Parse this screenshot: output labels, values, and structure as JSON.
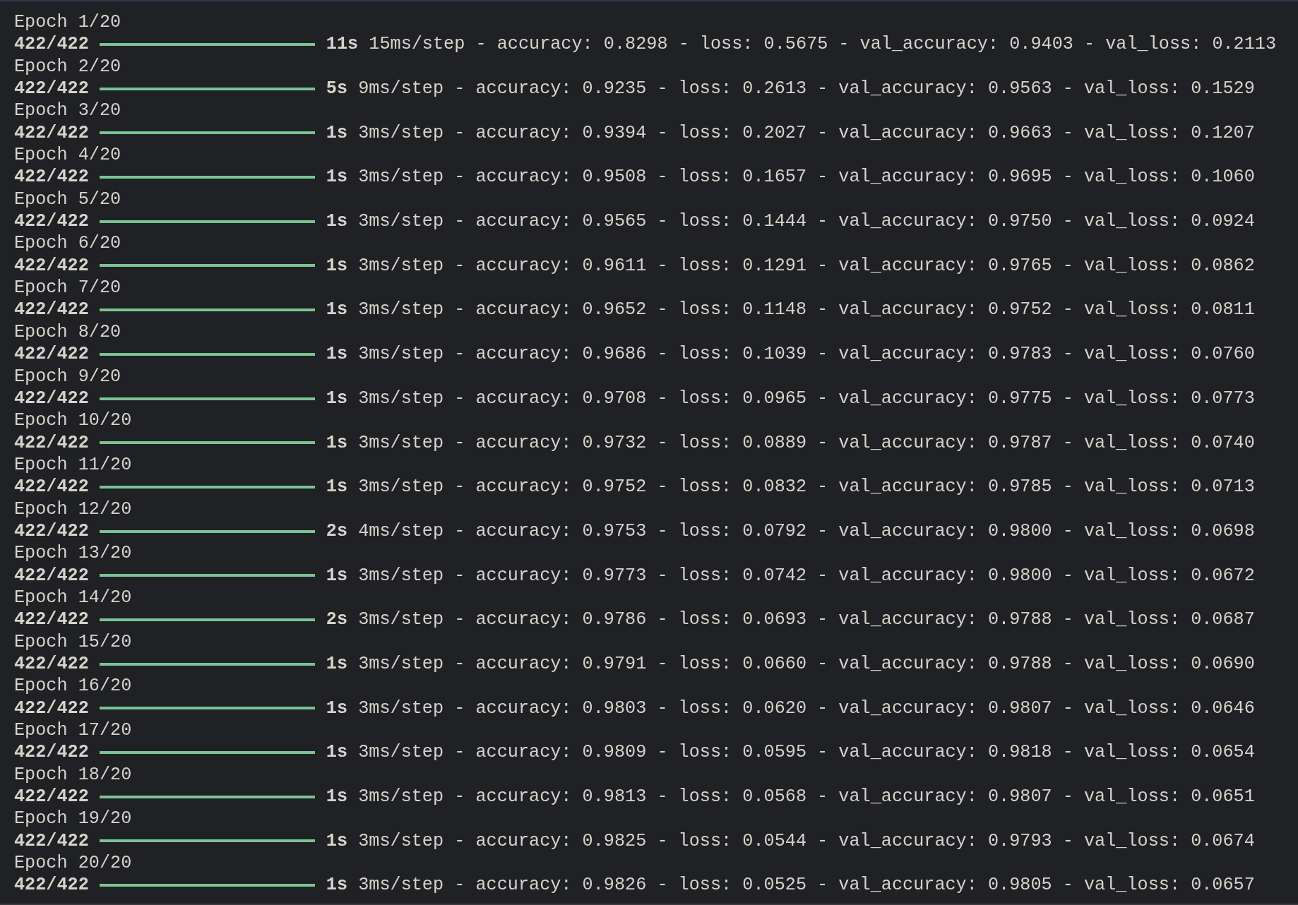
{
  "epochs": [
    {
      "header": "Epoch 1/20",
      "steps": "422/422",
      "level": 1,
      "time": "11s",
      "detail": "15ms/step - accuracy: 0.8298 - loss: 0.5675 - val_accuracy: 0.9403 - val_loss: 0.2113"
    },
    {
      "header": "Epoch 2/20",
      "steps": "422/422",
      "level": 1,
      "time": "5s",
      "detail": "9ms/step - accuracy: 0.9235 - loss: 0.2613 - val_accuracy: 0.9563 - val_loss: 0.1529"
    },
    {
      "header": "Epoch 3/20",
      "steps": "422/422",
      "level": 1,
      "time": "1s",
      "detail": "3ms/step - accuracy: 0.9394 - loss: 0.2027 - val_accuracy: 0.9663 - val_loss: 0.1207"
    },
    {
      "header": "Epoch 4/20",
      "steps": "422/422",
      "level": 1,
      "time": "1s",
      "detail": "3ms/step - accuracy: 0.9508 - loss: 0.1657 - val_accuracy: 0.9695 - val_loss: 0.1060"
    },
    {
      "header": "Epoch 5/20",
      "steps": "422/422",
      "level": 1,
      "time": "1s",
      "detail": "3ms/step - accuracy: 0.9565 - loss: 0.1444 - val_accuracy: 0.9750 - val_loss: 0.0924"
    },
    {
      "header": "Epoch 6/20",
      "steps": "422/422",
      "level": 1,
      "time": "1s",
      "detail": "3ms/step - accuracy: 0.9611 - loss: 0.1291 - val_accuracy: 0.9765 - val_loss: 0.0862"
    },
    {
      "header": "Epoch 7/20",
      "steps": "422/422",
      "level": 1,
      "time": "1s",
      "detail": "3ms/step - accuracy: 0.9652 - loss: 0.1148 - val_accuracy: 0.9752 - val_loss: 0.0811"
    },
    {
      "header": "Epoch 8/20",
      "steps": "422/422",
      "level": 1,
      "time": "1s",
      "detail": "3ms/step - accuracy: 0.9686 - loss: 0.1039 - val_accuracy: 0.9783 - val_loss: 0.0760"
    },
    {
      "header": "Epoch 9/20",
      "steps": "422/422",
      "level": 1,
      "time": "1s",
      "detail": "3ms/step - accuracy: 0.9708 - loss: 0.0965 - val_accuracy: 0.9775 - val_loss: 0.0773"
    },
    {
      "header": "Epoch 10/20",
      "steps": "422/422",
      "level": 1,
      "time": "1s",
      "detail": "3ms/step - accuracy: 0.9732 - loss: 0.0889 - val_accuracy: 0.9787 - val_loss: 0.0740"
    },
    {
      "header": "Epoch 11/20",
      "steps": "422/422",
      "level": 1,
      "time": "1s",
      "detail": "3ms/step - accuracy: 0.9752 - loss: 0.0832 - val_accuracy: 0.9785 - val_loss: 0.0713"
    },
    {
      "header": "Epoch 12/20",
      "steps": "422/422",
      "level": 1,
      "time": "2s",
      "detail": "4ms/step - accuracy: 0.9753 - loss: 0.0792 - val_accuracy: 0.9800 - val_loss: 0.0698"
    },
    {
      "header": "Epoch 13/20",
      "steps": "422/422",
      "level": 1,
      "time": "1s",
      "detail": "3ms/step - accuracy: 0.9773 - loss: 0.0742 - val_accuracy: 0.9800 - val_loss: 0.0672"
    },
    {
      "header": "Epoch 14/20",
      "steps": "422/422",
      "level": 1,
      "time": "2s",
      "detail": "3ms/step - accuracy: 0.9786 - loss: 0.0693 - val_accuracy: 0.9788 - val_loss: 0.0687"
    },
    {
      "header": "Epoch 15/20",
      "steps": "422/422",
      "level": 1,
      "time": "1s",
      "detail": "3ms/step - accuracy: 0.9791 - loss: 0.0660 - val_accuracy: 0.9788 - val_loss: 0.0690"
    },
    {
      "header": "Epoch 16/20",
      "steps": "422/422",
      "level": 1,
      "time": "1s",
      "detail": "3ms/step - accuracy: 0.9803 - loss: 0.0620 - val_accuracy: 0.9807 - val_loss: 0.0646"
    },
    {
      "header": "Epoch 17/20",
      "steps": "422/422",
      "level": 1,
      "time": "1s",
      "detail": "3ms/step - accuracy: 0.9809 - loss: 0.0595 - val_accuracy: 0.9818 - val_loss: 0.0654"
    },
    {
      "header": "Epoch 18/20",
      "steps": "422/422",
      "level": 1,
      "time": "1s",
      "detail": "3ms/step - accuracy: 0.9813 - loss: 0.0568 - val_accuracy: 0.9807 - val_loss: 0.0651"
    },
    {
      "header": "Epoch 19/20",
      "steps": "422/422",
      "level": 1,
      "time": "1s",
      "detail": "3ms/step - accuracy: 0.9825 - loss: 0.0544 - val_accuracy: 0.9793 - val_loss: 0.0674"
    },
    {
      "header": "Epoch 20/20",
      "steps": "422/422",
      "level": 1,
      "time": "1s",
      "detail": "3ms/step - accuracy: 0.9826 - loss: 0.0525 - val_accuracy: 0.9805 - val_loss: 0.0657"
    }
  ]
}
